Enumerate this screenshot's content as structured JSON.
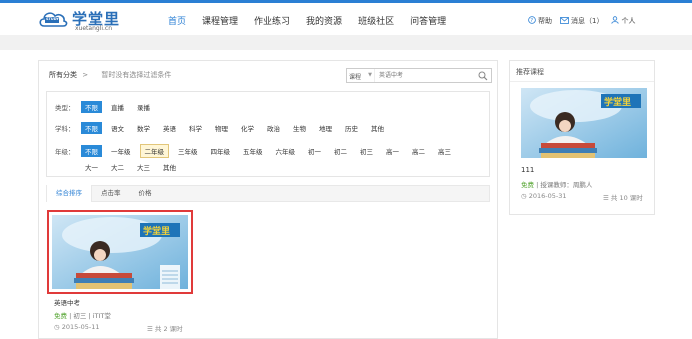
{
  "logo": {
    "text": "学堂里",
    "sub": "xuetangli.cn",
    "badge": "STUDY"
  },
  "nav": {
    "items": [
      {
        "label": "首页"
      },
      {
        "label": "课程管理"
      },
      {
        "label": "作业练习"
      },
      {
        "label": "我的资源"
      },
      {
        "label": "班级社区"
      },
      {
        "label": "问答管理"
      }
    ],
    "active_index": 0
  },
  "header_right": {
    "help": "帮助",
    "messages": "消息（1）",
    "personal": "个人"
  },
  "breadcrumb": {
    "all": "所有分类",
    "sep": ">",
    "hint": "暂时没有选择过滤条件"
  },
  "search": {
    "scope": "课程",
    "placeholder": "英语中考"
  },
  "filters": {
    "type": {
      "label": "类型：",
      "options": [
        "不限",
        "直播",
        "录播"
      ]
    },
    "subject": {
      "label": "学科：",
      "options": [
        "不限",
        "语文",
        "数学",
        "英语",
        "科学",
        "物理",
        "化学",
        "政治",
        "生物",
        "地理",
        "历史",
        "其他"
      ]
    },
    "grade": {
      "label": "年级：",
      "row1": [
        "不限",
        "一年级",
        "二年级",
        "三年级",
        "四年级",
        "五年级",
        "六年级",
        "初一",
        "初二",
        "初三",
        "高一",
        "高二",
        "高三"
      ],
      "row2": [
        "大一",
        "大二",
        "大三",
        "其他"
      ]
    }
  },
  "tabs": [
    "综合排序",
    "点击率",
    "价格"
  ],
  "course": {
    "title": "英语中考",
    "price": "免费",
    "grade": "初三",
    "teacher": "iTIT堂",
    "date": "2015-05-11",
    "lessons": "共 2 课时"
  },
  "recommend": {
    "title": "推荐课程",
    "name": "111",
    "price": "免费",
    "teacher_label": "授课教师：",
    "teacher": "周鹏人",
    "date": "2016-05-31",
    "lessons": "共 10 课时"
  },
  "colors": {
    "accent": "#2a7fd4",
    "free": "#55a532",
    "highlight_border": "#e03a3a"
  }
}
